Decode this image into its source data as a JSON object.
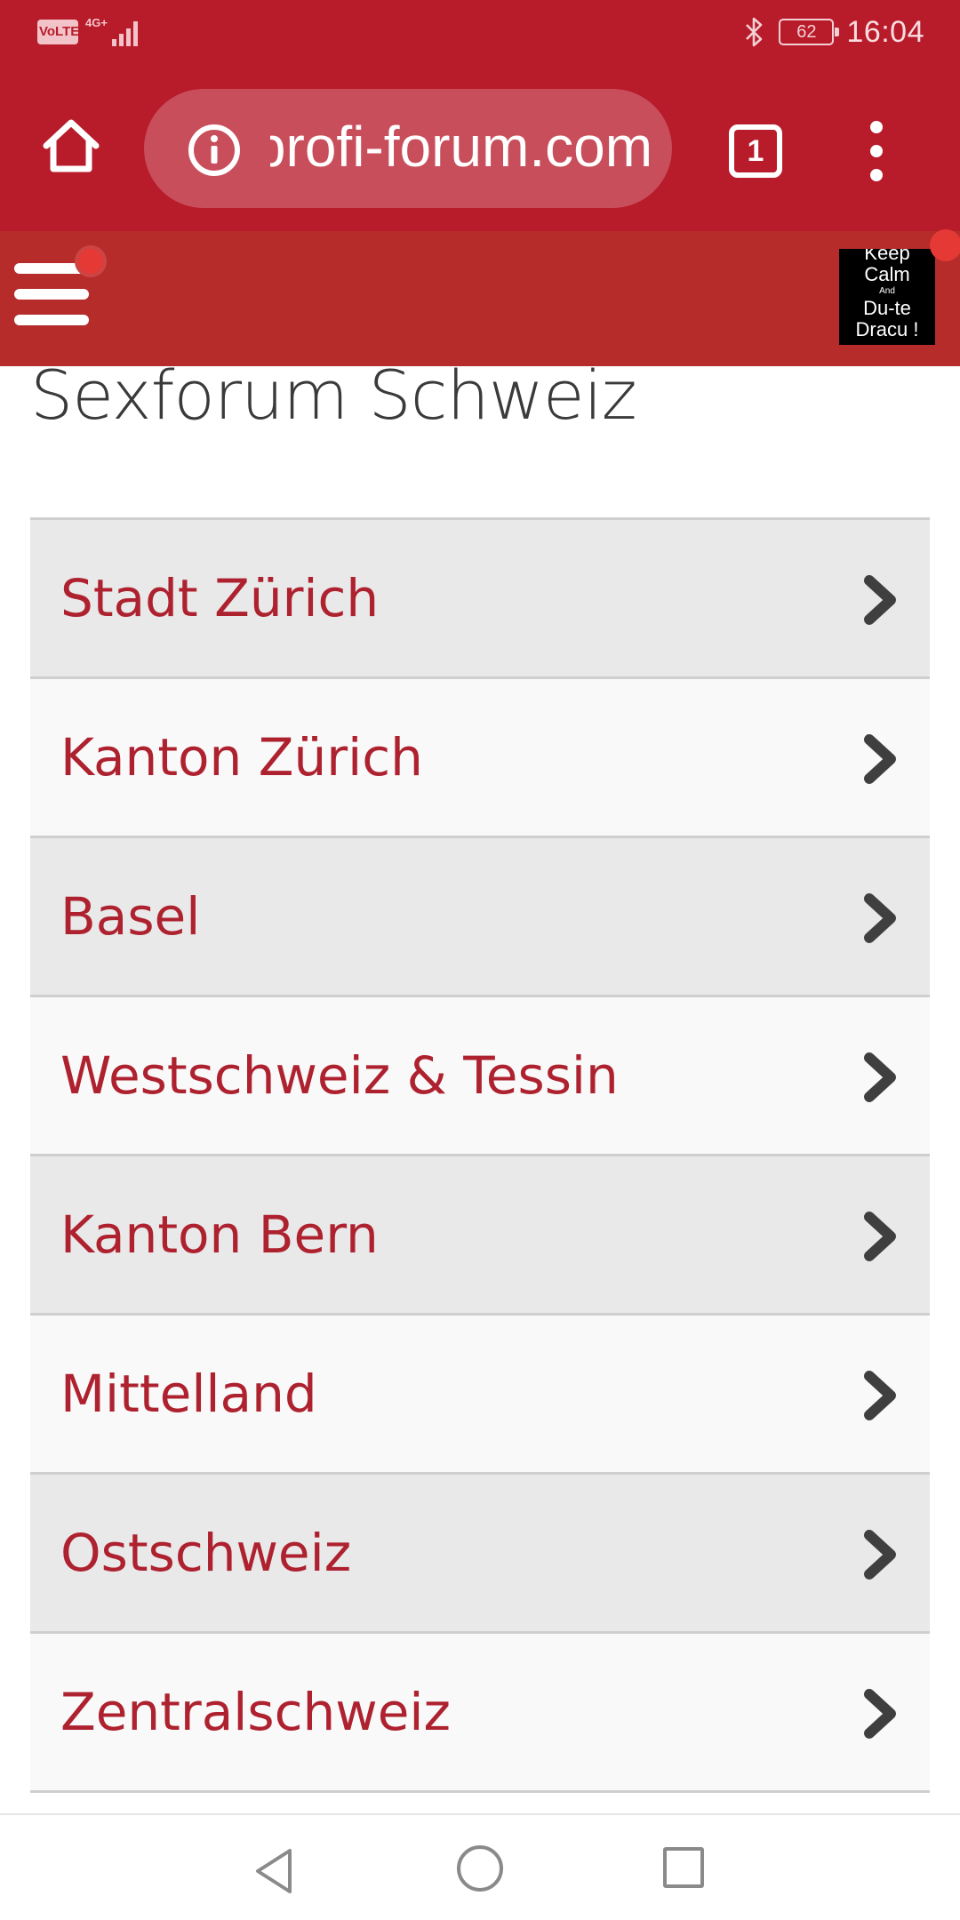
{
  "status_bar": {
    "volte": "VoLTE",
    "network": "4G+",
    "battery": "62",
    "time": "16:04"
  },
  "browser": {
    "url": "profi-forum.com",
    "tab_count": "1",
    "theme_color": "#B81B2A"
  },
  "site_header": {
    "avatar": {
      "line1": "Keep",
      "line2": "Calm",
      "line3": "And",
      "line4": "Du-te",
      "line5": "Dracu !"
    }
  },
  "page": {
    "title": "Sexforum Schweiz"
  },
  "forums": [
    {
      "label": "Stadt Zürich"
    },
    {
      "label": "Kanton Zürich"
    },
    {
      "label": "Basel"
    },
    {
      "label": "Westschweiz & Tessin"
    },
    {
      "label": "Kanton Bern"
    },
    {
      "label": "Mittelland"
    },
    {
      "label": "Ostschweiz"
    },
    {
      "label": "Zentralschweiz"
    }
  ],
  "colors": {
    "link": "#AE2230",
    "header": "#B52C2A",
    "notification": "#E53935"
  }
}
